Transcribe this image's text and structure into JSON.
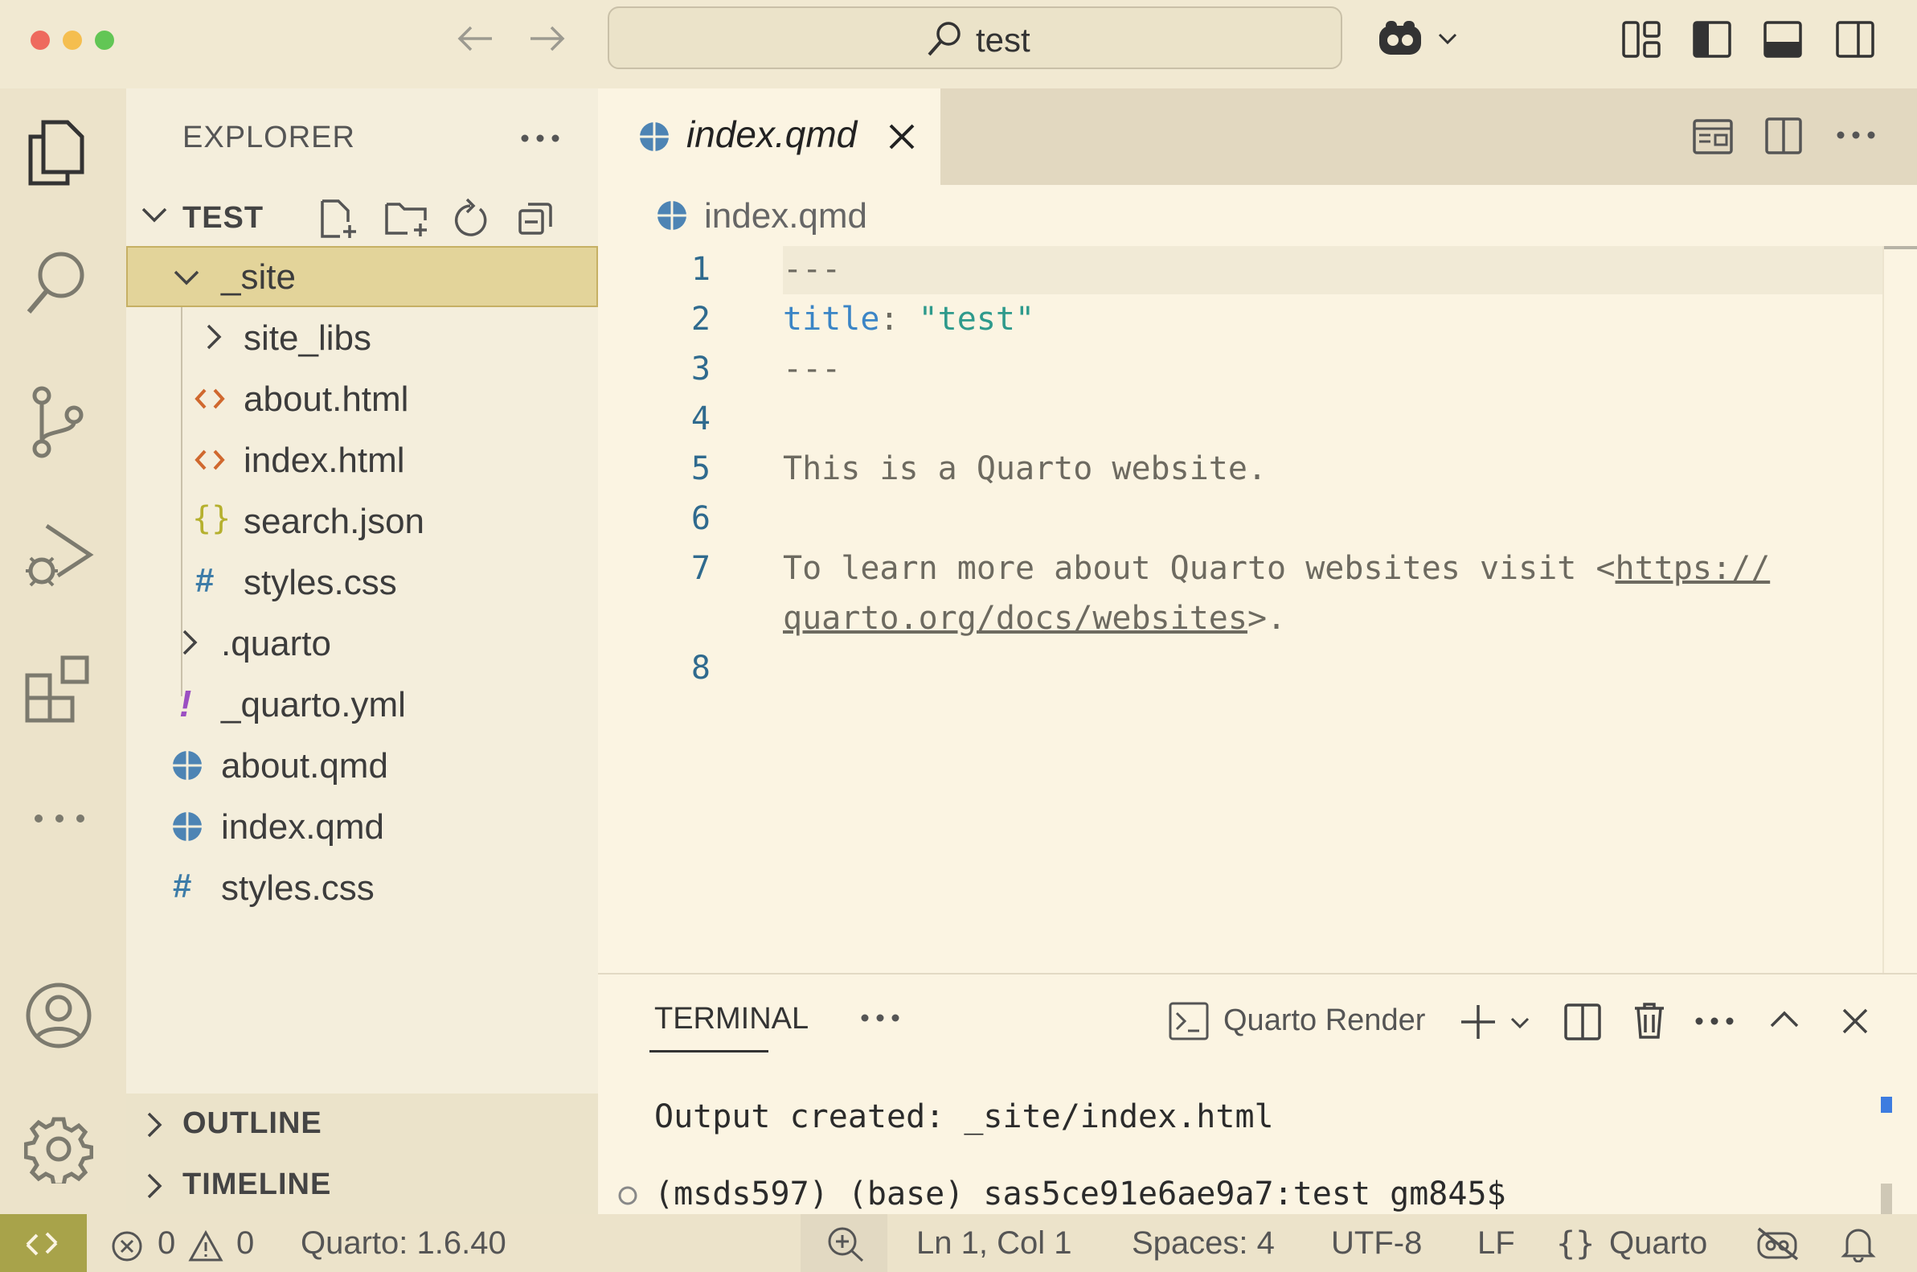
{
  "titlebar": {
    "search_text": "test"
  },
  "sidebar": {
    "title": "EXPLORER",
    "folder_name": "TEST",
    "tree": [
      {
        "label": "_site",
        "icon": "chevron-down-icon"
      },
      {
        "label": "site_libs",
        "icon": "chevron-right-icon"
      },
      {
        "label": "about.html",
        "icon": "html-file-icon"
      },
      {
        "label": "index.html",
        "icon": "html-file-icon"
      },
      {
        "label": "search.json",
        "icon": "json-file-icon"
      },
      {
        "label": "styles.css",
        "icon": "css-file-icon"
      },
      {
        "label": ".quarto",
        "icon": "chevron-right-icon"
      },
      {
        "label": "_quarto.yml",
        "icon": "yaml-file-icon"
      },
      {
        "label": "about.qmd",
        "icon": "quarto-file-icon"
      },
      {
        "label": "index.qmd",
        "icon": "quarto-file-icon"
      },
      {
        "label": "styles.css",
        "icon": "css-file-icon"
      }
    ],
    "outline": "OUTLINE",
    "timeline": "TIMELINE"
  },
  "editor": {
    "tab_label": "index.qmd",
    "breadcrumb": "index.qmd",
    "line_numbers": [
      "1",
      "2",
      "3",
      "4",
      "5",
      "6",
      "7",
      "8"
    ],
    "lines": {
      "l1": "---",
      "l2_key": "title",
      "l2_colon": ": ",
      "l2_value": "\"test\"",
      "l3": "---",
      "l5": "This is a Quarto website.",
      "l7_text": "To learn more about Quarto websites visit <",
      "l7_link1": "https://",
      "l7_link2": "quarto.org/docs/websites",
      "l7_end": ">."
    }
  },
  "panel": {
    "tab_label": "TERMINAL",
    "terminal_name": "Quarto Render",
    "output_line": "Output created: _site/index.html",
    "prompt_line": "(msds597) (base) sas5ce91e6ae9a7:test gm845$"
  },
  "statusbar": {
    "errors": "0",
    "warnings": "0",
    "quarto_version": "Quarto: 1.6.40",
    "position": "Ln 1, Col 1",
    "spaces": "Spaces: 4",
    "encoding": "UTF-8",
    "eol": "LF",
    "language": "Quarto",
    "accent_color": "#a8a34a"
  }
}
